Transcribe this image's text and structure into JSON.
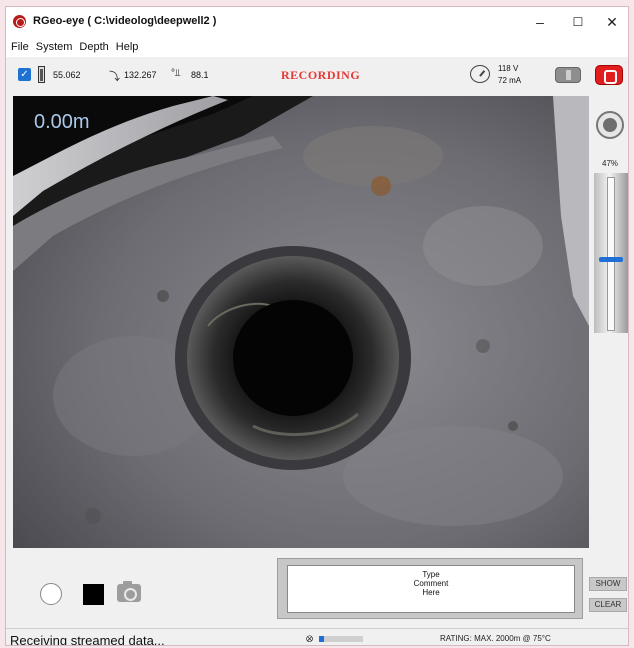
{
  "window": {
    "title": "RGeo-eye ( C:\\videolog\\deepwell2 )",
    "minimize_glyph": "–",
    "maximize_glyph": "☐",
    "close_glyph": "✕"
  },
  "menu": [
    "File",
    "System",
    "Depth",
    "Help"
  ],
  "toolbar": {
    "enabled_check": "✓",
    "reading_1": "55.062",
    "reading_2": "132.267",
    "reading_3": "88.1",
    "status": "RECORDING",
    "voltage": "118 V",
    "current": "72 mA"
  },
  "video": {
    "depth_overlay": "0.00m"
  },
  "controls": {
    "slider_percent_label": "47%",
    "slider_value_percent": 47,
    "comment_placeholder": "Type\nComment\nHere",
    "show_label": "SHOW",
    "clear_label": "CLEAR"
  },
  "status_bar": {
    "message": "Receiving streamed data...",
    "progress_fraction": 0.12,
    "rating": "RATING: MAX. 2000m @ 75°C"
  },
  "icons": {
    "app": "app-logo-icon",
    "battery": "battery-icon",
    "heading": "compass-icon",
    "inclination": "inclination-icon",
    "gauge": "gauge-icon",
    "plug": "plug-icon",
    "camera": "camera-icon"
  },
  "colors": {
    "recording": "#e53935",
    "record_toggle": "#e11d1d",
    "slider_thumb": "#1e6fd6",
    "depth_overlay": "#a8c8ec"
  }
}
